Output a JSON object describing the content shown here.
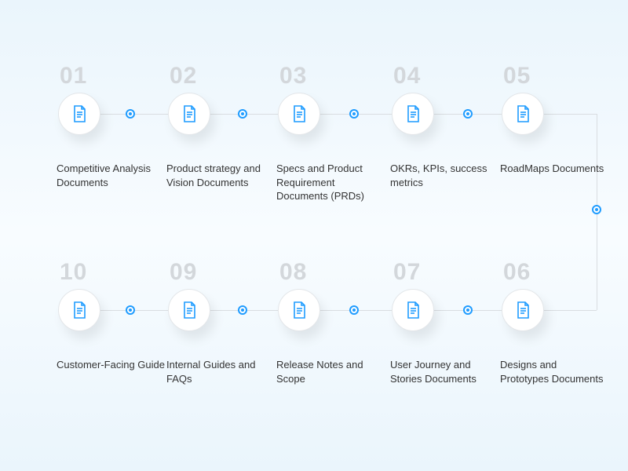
{
  "steps": [
    {
      "num": "01",
      "label": "Competitive Analysis Documents"
    },
    {
      "num": "02",
      "label": "Product strategy and Vision Documents"
    },
    {
      "num": "03",
      "label": "Specs and Product Requirement Documents (PRDs)"
    },
    {
      "num": "04",
      "label": "OKRs, KPIs, success metrics"
    },
    {
      "num": "05",
      "label": "RoadMaps Documents"
    },
    {
      "num": "06",
      "label": "Designs and Prototypes Documents"
    },
    {
      "num": "07",
      "label": "User Journey and Stories Documents"
    },
    {
      "num": "08",
      "label": "Release Notes and Scope"
    },
    {
      "num": "09",
      "label": "Internal Guides and FAQs"
    },
    {
      "num": "10",
      "label": "Customer-Facing Guide"
    }
  ],
  "colors": {
    "accent": "#1f9cff"
  }
}
